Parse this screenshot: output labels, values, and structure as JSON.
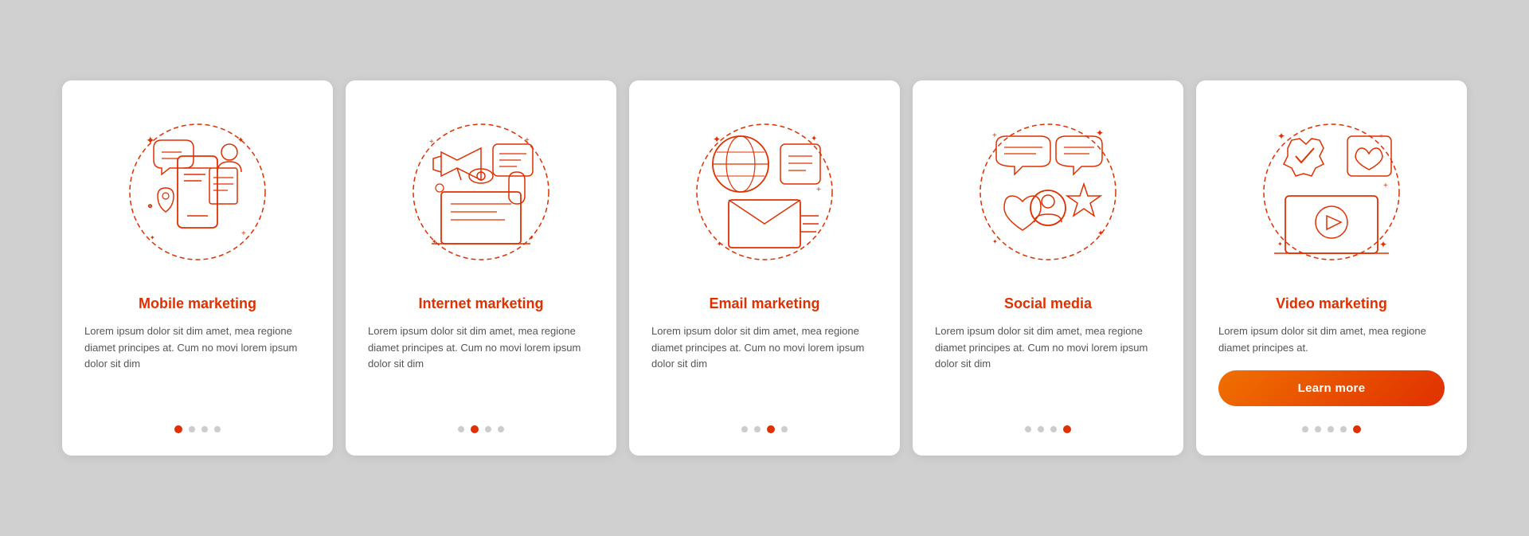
{
  "cards": [
    {
      "id": "mobile-marketing",
      "title": "Mobile marketing",
      "text": "Lorem ipsum dolor sit dim amet, mea regione diamet principes at. Cum no movi lorem ipsum dolor sit dim",
      "dots": [
        1,
        2,
        3,
        4
      ],
      "active_dot": 1,
      "show_button": false,
      "button_label": ""
    },
    {
      "id": "internet-marketing",
      "title": "Internet marketing",
      "text": "Lorem ipsum dolor sit dim amet, mea regione diamet principes at. Cum no movi lorem ipsum dolor sit dim",
      "dots": [
        1,
        2,
        3,
        4
      ],
      "active_dot": 2,
      "show_button": false,
      "button_label": ""
    },
    {
      "id": "email-marketing",
      "title": "Email marketing",
      "text": "Lorem ipsum dolor sit dim amet, mea regione diamet principes at. Cum no movi lorem ipsum dolor sit dim",
      "dots": [
        1,
        2,
        3,
        4
      ],
      "active_dot": 3,
      "show_button": false,
      "button_label": ""
    },
    {
      "id": "social-media",
      "title": "Social media",
      "text": "Lorem ipsum dolor sit dim amet, mea regione diamet principes at. Cum no movi lorem ipsum dolor sit dim",
      "dots": [
        1,
        2,
        3,
        4
      ],
      "active_dot": 4,
      "show_button": false,
      "button_label": ""
    },
    {
      "id": "video-marketing",
      "title": "Video marketing",
      "text": "Lorem ipsum dolor sit dim amet, mea regione diamet principes at.",
      "dots": [
        1,
        2,
        3,
        4
      ],
      "active_dot": 5,
      "show_button": true,
      "button_label": "Learn more"
    }
  ],
  "accent_color": "#e03000",
  "orange_color": "#f07000"
}
